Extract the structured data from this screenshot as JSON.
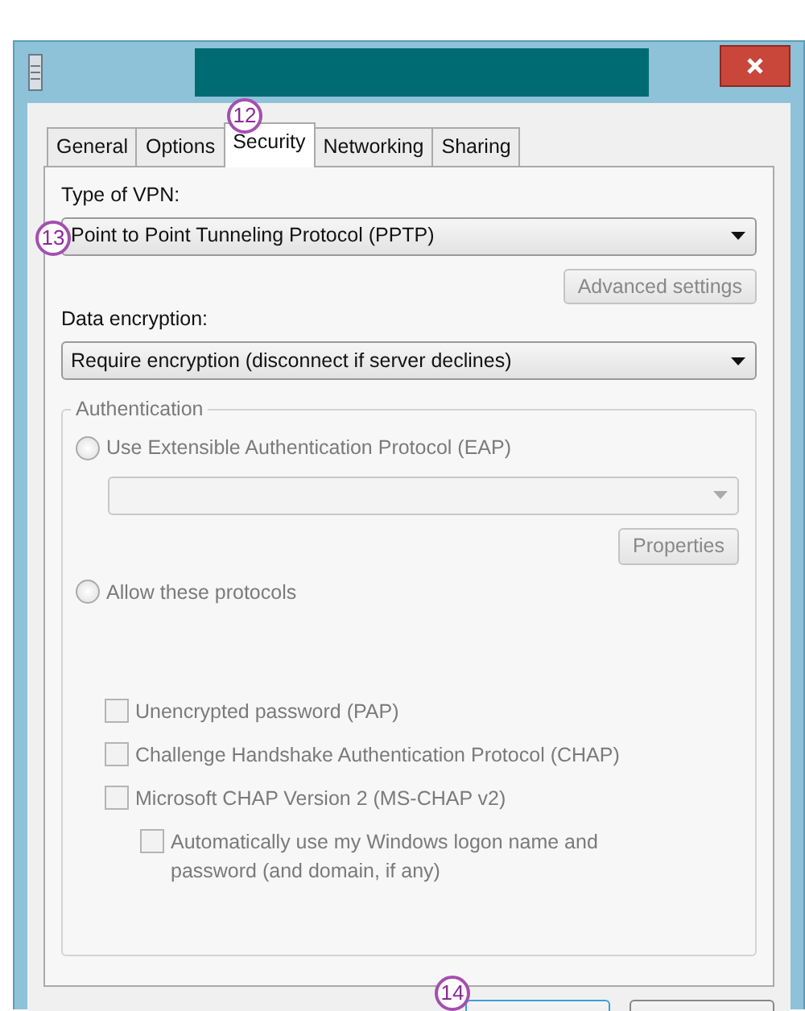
{
  "window": {
    "title_redacted": true
  },
  "tabs": [
    {
      "label": "General",
      "selected": false
    },
    {
      "label": "Options",
      "selected": false
    },
    {
      "label": "Security",
      "selected": true
    },
    {
      "label": "Networking",
      "selected": false
    },
    {
      "label": "Sharing",
      "selected": false
    }
  ],
  "vpn_type": {
    "label": "Type of VPN:",
    "value": "Point to Point Tunneling Protocol (PPTP)"
  },
  "advanced_button": {
    "label": "Advanced settings",
    "disabled": true
  },
  "data_encryption": {
    "label": "Data encryption:",
    "value": "Require encryption (disconnect if server declines)"
  },
  "authentication": {
    "title": "Authentication",
    "disabled": true,
    "eap_radio": {
      "label": "Use Extensible Authentication Protocol (EAP)",
      "selected": false
    },
    "eap_dropdown": {
      "disabled": true
    },
    "properties_button": {
      "label": "Properties",
      "disabled": true
    },
    "protocols_radio": {
      "label": "Allow these protocols",
      "selected": false
    },
    "protocols": [
      {
        "label": "Unencrypted password (PAP)",
        "checked": false,
        "indented": false
      },
      {
        "label": "Challenge Handshake Authentication Protocol (CHAP)",
        "checked": false,
        "indented": false
      },
      {
        "label": "Microsoft CHAP Version 2 (MS-CHAP v2)",
        "checked": false,
        "indented": false
      },
      {
        "label": "Automatically use my Windows logon name and password (and domain, if any)",
        "checked": false,
        "indented": true
      }
    ]
  },
  "callouts": [
    {
      "kind": "tab",
      "text": "12"
    },
    {
      "kind": "vpn",
      "text": "13"
    },
    {
      "kind": "footer",
      "text": "14"
    }
  ],
  "footer_buttons": [
    {
      "kind": "default"
    },
    {
      "kind": "normal"
    }
  ]
}
